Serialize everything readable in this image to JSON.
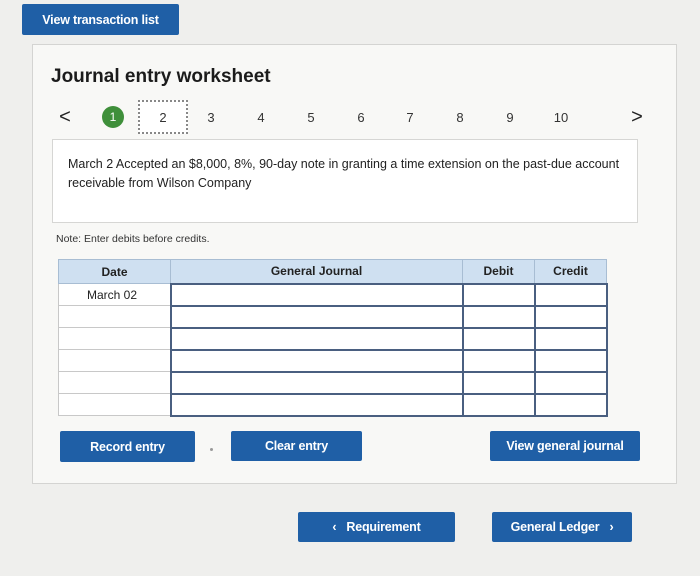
{
  "toolbar": {
    "view_transaction_list": "View transaction list"
  },
  "worksheet": {
    "title": "Journal entry worksheet",
    "pager": {
      "prev": "<",
      "next": ">",
      "pages": [
        "1",
        "2",
        "3",
        "4",
        "5",
        "6",
        "7",
        "8",
        "9",
        "10"
      ],
      "completed_page": "1",
      "current_page": "2"
    },
    "description": "March 2 Accepted an $8,000, 8%, 90-day note in granting a time extension on the past-due account receivable from Wilson Company",
    "note": "Note: Enter debits before credits.",
    "table": {
      "headers": {
        "date": "Date",
        "journal": "General Journal",
        "debit": "Debit",
        "credit": "Credit"
      },
      "rows": [
        {
          "date": "March 02",
          "account": "",
          "debit": "",
          "credit": ""
        },
        {
          "date": "",
          "account": "",
          "debit": "",
          "credit": ""
        },
        {
          "date": "",
          "account": "",
          "debit": "",
          "credit": ""
        },
        {
          "date": "",
          "account": "",
          "debit": "",
          "credit": ""
        },
        {
          "date": "",
          "account": "",
          "debit": "",
          "credit": ""
        },
        {
          "date": "",
          "account": "",
          "debit": "",
          "credit": ""
        }
      ]
    },
    "buttons": {
      "record_entry": "Record entry",
      "clear_entry": "Clear entry",
      "view_general_journal": "View general journal"
    }
  },
  "footer": {
    "requirement": "Requirement",
    "general_ledger": "General Ledger"
  },
  "colors": {
    "accent": "#1f5fa6",
    "completed": "#3f8f3a",
    "header": "#cfe0f1"
  }
}
